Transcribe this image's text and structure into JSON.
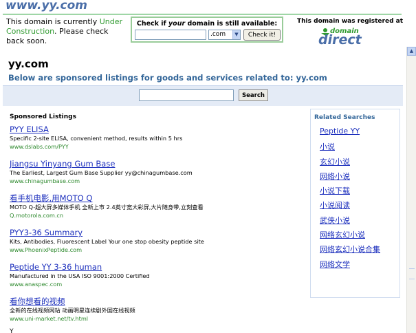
{
  "header": {
    "site_title": "www.yy.com",
    "construction_prefix": "This domain is currently ",
    "construction_highlight": "Under Construction",
    "construction_suffix": ". Please check back soon.",
    "check_prefix": "Check if ",
    "check_emphasis": "your",
    "check_suffix": " domain is still available:",
    "domain_input_value": "",
    "tld_selected": ".com",
    "check_button_label": "Check it!",
    "registered_text": "This domain was registered at",
    "logo_small": "domain",
    "logo_large": "direct"
  },
  "main": {
    "heading": "yy.com",
    "subheading": "Below are sponsored listings for goods and services related to: yy.com",
    "search_input_value": "",
    "search_button_label": "Search",
    "listings_heading": "Sponsored Listings",
    "listings": [
      {
        "title": "PYY ELISA",
        "desc": "Specific 2-site ELISA, convenient method, results within 5 hrs",
        "url": "www.dslabs.com/PYY"
      },
      {
        "title": "Jiangsu Yinyang Gum Base",
        "desc": "The Earliest, Largest Gum Base Supplier yy@chinagumbase.com",
        "url": "www.chinagumbase.com"
      },
      {
        "title": "看手机电影,用MOTO Q",
        "desc": "MOTO Q-超大屏多媒体手机 全新上市 2.4英寸宽大彩屏,大片随身带,立刻查看",
        "url": "Q.motorola.com.cn"
      },
      {
        "title": "PYY3-36 Summary",
        "desc": "Kits, Antibodies, Fluorescent Label Your one stop obesity peptide site",
        "url": "www.PhoenixPeptide.com"
      },
      {
        "title": "Peptide YY 3-36 human",
        "desc": "Manufactured in the USA ISO 9001:2000 Certified",
        "url": "www.anaspec.com"
      },
      {
        "title": "看你想看的视频",
        "desc": "全新的在线视频网站 动画明星连续剧外国在线视频",
        "url": "www.uni-market.net/tv.html"
      }
    ],
    "cut_text": "Y",
    "related_heading": "Related Searches",
    "related": [
      "Peptide YY",
      "小说",
      "玄幻小说",
      "网络小说",
      "小说下载",
      "小说阅读",
      "武侠小说",
      "网络玄幻小说",
      "网络玄幻小说合集",
      "网络文学"
    ]
  },
  "colors": {
    "title_blue": "#4a6ea8",
    "link_blue": "#1c2fbd",
    "url_green": "#2f8a2f",
    "accent_green": "#2f9a2f",
    "heading_blue": "#336699",
    "search_bar_bg": "#e4ebf6"
  }
}
